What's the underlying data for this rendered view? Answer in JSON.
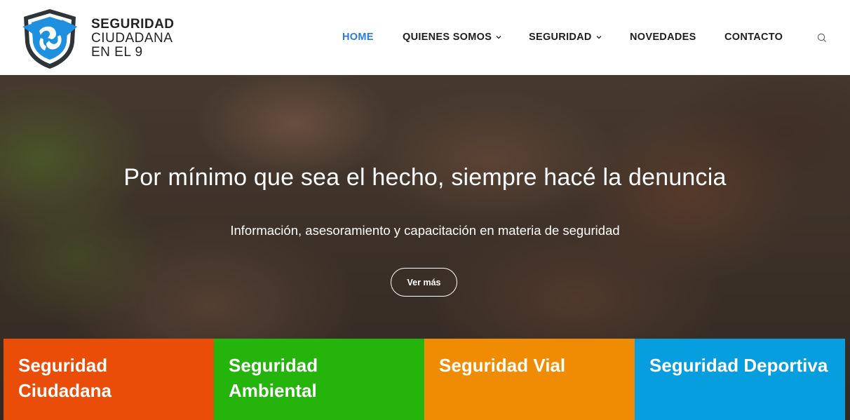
{
  "site": {
    "logo": {
      "line1": "SEGURIDAD",
      "line2": "CIUDADANA",
      "line3": "EN EL 9",
      "icon": "shield-hands-icon",
      "colors": {
        "shield_border": "#2f3438",
        "shield_fill": "#1f8fe0",
        "hands": "#ffffff"
      }
    }
  },
  "nav": {
    "items": [
      {
        "label": "HOME",
        "active": true
      },
      {
        "label": "QUIENES SOMOS",
        "dropdown": true
      },
      {
        "label": "SEGURIDAD",
        "dropdown": true
      },
      {
        "label": "NOVEDADES"
      },
      {
        "label": "CONTACTO"
      }
    ],
    "search_icon": "search-icon",
    "active_color": "#2a7ae2"
  },
  "hero": {
    "title": "Por mínimo que sea el hecho, siempre hacé la denuncia",
    "subtitle": "Información, asesoramiento y capacitación en materia de seguridad",
    "button_label": "Ver más"
  },
  "categories": [
    {
      "title_line1": "Seguridad",
      "title_line2": "Ciudadana",
      "color": "#e94d08"
    },
    {
      "title_line1": "Seguridad",
      "title_line2": "Ambiental",
      "color": "#25b40b"
    },
    {
      "title_line1": "Seguridad Vial",
      "title_line2": "",
      "color": "#ef8c04"
    },
    {
      "title_line1": "Seguridad Deportiva",
      "title_line2": "",
      "color": "#069ede"
    }
  ]
}
